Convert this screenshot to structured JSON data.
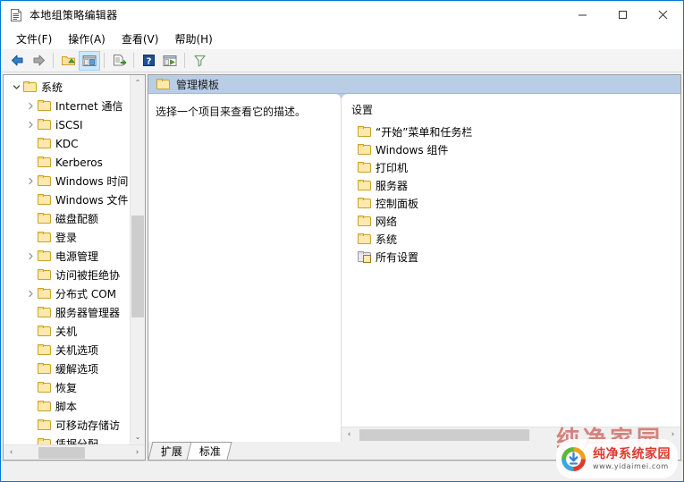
{
  "window": {
    "title": "本地组策略编辑器",
    "icon": "policy-document-icon",
    "minimize": "—",
    "maximize": "□",
    "close": "✕"
  },
  "menubar": {
    "items": [
      {
        "label": "文件(F)",
        "name": "menu-file"
      },
      {
        "label": "操作(A)",
        "name": "menu-action"
      },
      {
        "label": "查看(V)",
        "name": "menu-view"
      },
      {
        "label": "帮助(H)",
        "name": "menu-help"
      }
    ]
  },
  "toolbar": {
    "buttons": [
      {
        "name": "back-button",
        "icon": "arrow-left-icon",
        "enabled": true
      },
      {
        "name": "forward-button",
        "icon": "arrow-right-icon",
        "enabled": false
      },
      {
        "name": "up-one-level-button",
        "icon": "folder-up-icon",
        "enabled": true
      },
      {
        "name": "show-console-tree-button",
        "icon": "console-tree-icon",
        "selected": true
      },
      {
        "name": "export-list-button",
        "icon": "export-list-icon",
        "enabled": true
      },
      {
        "name": "help-button",
        "icon": "question-mark-icon",
        "enabled": true
      },
      {
        "name": "properties-button",
        "icon": "properties-window-icon",
        "enabled": true
      },
      {
        "name": "filter-button",
        "icon": "funnel-filter-icon",
        "enabled": true
      }
    ]
  },
  "tree": {
    "items": [
      {
        "label": "系统",
        "depth": 0,
        "twisty": "expanded",
        "icon": "folder-icon"
      },
      {
        "label": "Internet 通信",
        "depth": 1,
        "twisty": "collapsed",
        "icon": "folder-icon"
      },
      {
        "label": "iSCSI",
        "depth": 1,
        "twisty": "collapsed",
        "icon": "folder-icon"
      },
      {
        "label": "KDC",
        "depth": 1,
        "twisty": "none",
        "icon": "folder-icon"
      },
      {
        "label": "Kerberos",
        "depth": 1,
        "twisty": "none",
        "icon": "folder-icon"
      },
      {
        "label": "Windows 时间",
        "depth": 1,
        "twisty": "collapsed",
        "icon": "folder-icon"
      },
      {
        "label": "Windows 文件",
        "depth": 1,
        "twisty": "none",
        "icon": "folder-icon"
      },
      {
        "label": "磁盘配额",
        "depth": 1,
        "twisty": "none",
        "icon": "folder-icon"
      },
      {
        "label": "登录",
        "depth": 1,
        "twisty": "none",
        "icon": "folder-icon"
      },
      {
        "label": "电源管理",
        "depth": 1,
        "twisty": "collapsed",
        "icon": "folder-icon"
      },
      {
        "label": "访问被拒绝协",
        "depth": 1,
        "twisty": "none",
        "icon": "folder-icon"
      },
      {
        "label": "分布式 COM",
        "depth": 1,
        "twisty": "collapsed",
        "icon": "folder-icon"
      },
      {
        "label": "服务器管理器",
        "depth": 1,
        "twisty": "none",
        "icon": "folder-icon"
      },
      {
        "label": "关机",
        "depth": 1,
        "twisty": "none",
        "icon": "folder-icon"
      },
      {
        "label": "关机选项",
        "depth": 1,
        "twisty": "none",
        "icon": "folder-icon"
      },
      {
        "label": "缓解选项",
        "depth": 1,
        "twisty": "none",
        "icon": "folder-icon"
      },
      {
        "label": "恢复",
        "depth": 1,
        "twisty": "none",
        "icon": "folder-icon"
      },
      {
        "label": "脚本",
        "depth": 1,
        "twisty": "none",
        "icon": "folder-icon"
      },
      {
        "label": "可移动存储访",
        "depth": 1,
        "twisty": "none",
        "icon": "folder-icon"
      },
      {
        "label": "凭据分配",
        "depth": 1,
        "twisty": "none",
        "icon": "folder-icon"
      }
    ],
    "scroll_up": "⌃",
    "scroll_down": "⌄",
    "scroll_left": "‹",
    "scroll_right": "›"
  },
  "result_pane": {
    "header": {
      "title": "管理模板",
      "icon": "folder-icon"
    },
    "description": "选择一个项目来查看它的描述。",
    "column_header": "设置",
    "items": [
      {
        "label": "“开始”菜单和任务栏",
        "icon": "folder-icon"
      },
      {
        "label": "Windows 组件",
        "icon": "folder-icon"
      },
      {
        "label": "打印机",
        "icon": "folder-icon"
      },
      {
        "label": "服务器",
        "icon": "folder-icon"
      },
      {
        "label": "控制面板",
        "icon": "folder-icon"
      },
      {
        "label": "网络",
        "icon": "folder-icon"
      },
      {
        "label": "系统",
        "icon": "folder-icon"
      },
      {
        "label": "所有设置",
        "icon": "all-settings-folder-icon"
      }
    ],
    "scroll_left": "‹",
    "scroll_right": "›"
  },
  "tabs": [
    {
      "label": "扩展",
      "active": false,
      "name": "tab-extended"
    },
    {
      "label": "标准",
      "active": true,
      "name": "tab-standard"
    }
  ],
  "watermark": {
    "brand": "纯净系统家园",
    "url": "www.yidaimei.com",
    "ghost": "纯净家园"
  },
  "colors": {
    "window_border": "#0078d7",
    "mmc_header": "#b9cde5",
    "toolbar_selected": "#cce8ff",
    "folder_fill": "#fde9ad",
    "folder_stroke": "#c9a227",
    "brand_red": "#e03a2f"
  }
}
